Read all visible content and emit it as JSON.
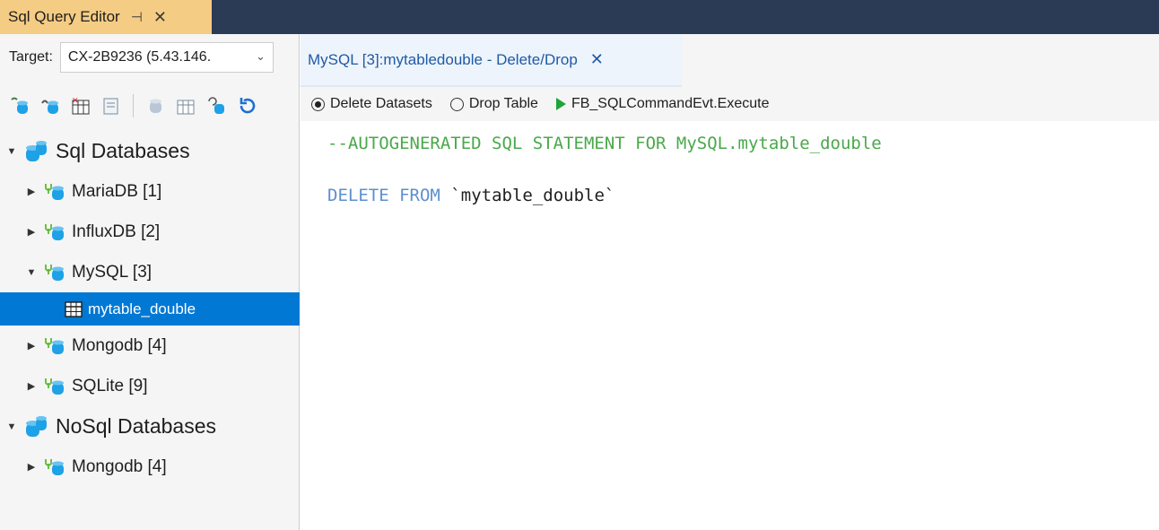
{
  "window": {
    "tab_title": "Sql Query Editor",
    "pin_glyph": "⊣",
    "close_glyph": "✕"
  },
  "left": {
    "target_label": "Target:",
    "target_value": "CX-2B9236 (5.43.146.",
    "target_arrow": "⌄",
    "toolbar_icons": [
      "connect-icon",
      "disconnect-icon",
      "delete-table-icon",
      "query-icon",
      "database-icon",
      "table-icon",
      "refresh-connection-icon",
      "refresh-icon"
    ]
  },
  "tree": {
    "sql_root": "Sql Databases",
    "mariadb": "MariaDB [1]",
    "influxdb": "InfluxDB [2]",
    "mysql": "MySQL [3]",
    "mytable": "mytable_double",
    "mongodb": "Mongodb [4]",
    "sqlite": "SQLite [9]",
    "nosql_root": "NoSql Databases",
    "nosql_mongodb": "Mongodb [4]"
  },
  "editor": {
    "tab_name": "MySQL [3]:mytabledouble - Delete/Drop",
    "tab_close": "✕",
    "opt_delete": "Delete Datasets",
    "opt_drop": "Drop Table",
    "execute_label": "FB_SQLCommandEvt.Execute",
    "comment_line": "--AUTOGENERATED SQL STATEMENT FOR MySQL.mytable_double",
    "kw_delete": "DELETE",
    "kw_from": "FROM",
    "table_ident": "`mytable_double`"
  },
  "colors": {
    "accent": "#0078d4",
    "tab_active": "#f5cc84",
    "titlebar": "#2b3a55",
    "comment": "#4aa84a",
    "keyword": "#5e8fcf"
  }
}
